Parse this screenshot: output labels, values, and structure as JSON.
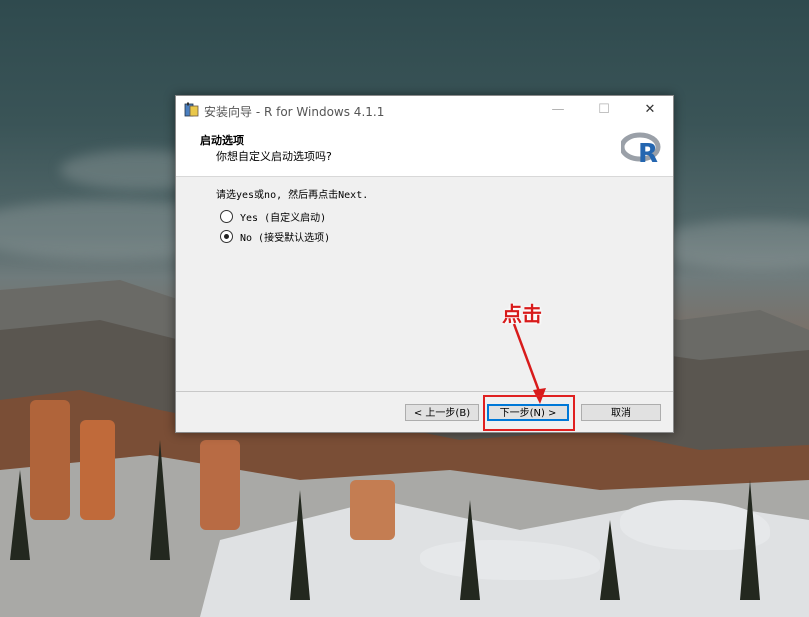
{
  "window": {
    "title": "安装向导 - R for Windows 4.1.1",
    "minimize_symbol": "—",
    "maximize_symbol": "☐",
    "close_symbol": "✕",
    "header_title": "启动选项",
    "header_subtitle": "你想自定义启动选项吗?",
    "logo_letter": "R"
  },
  "content": {
    "instruction": "请选yes或no, 然后再点击Next.",
    "options": [
      {
        "label": "Yes (自定义启动)",
        "checked": false
      },
      {
        "label": "No (接受默认选项)",
        "checked": true
      }
    ]
  },
  "buttons": {
    "back": "< 上一步(B)",
    "next": "下一步(N) >",
    "cancel": "取消"
  },
  "annotation": {
    "text": "点击",
    "color": "#d81b1b"
  },
  "icons": [
    "app-setup-icon",
    "r-logo-icon",
    "minimize-icon",
    "maximize-icon",
    "close-icon"
  ]
}
